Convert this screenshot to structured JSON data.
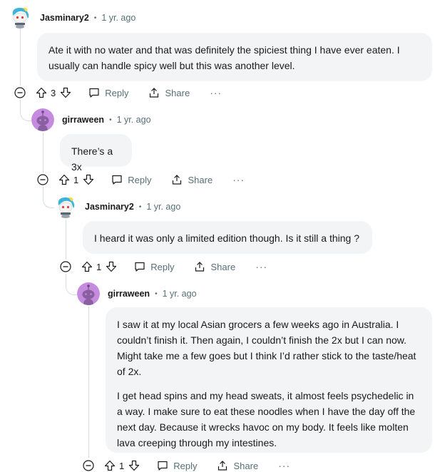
{
  "comments": [
    {
      "author": "Jasminary2",
      "separator": "•",
      "time": "1 yr. ago",
      "body": [
        "Ate it with no water and that was definitely the spiciest thing I have ever eaten. I usually can handle spicy well but this was another level."
      ],
      "score": "3",
      "reply": "Reply",
      "share": "Share",
      "more": "···"
    },
    {
      "author": "girraween",
      "separator": "•",
      "time": "1 yr. ago",
      "body": [
        "There’s a 3x"
      ],
      "score": "1",
      "reply": "Reply",
      "share": "Share",
      "more": "···"
    },
    {
      "author": "Jasminary2",
      "separator": "•",
      "time": "1 yr. ago",
      "body": [
        "I heard it was only a limited edition though. Is it still a thing ?"
      ],
      "score": "1",
      "reply": "Reply",
      "share": "Share",
      "more": "···"
    },
    {
      "author": "girraween",
      "separator": "•",
      "time": "1 yr. ago",
      "body": [
        "I saw it at my local Asian grocers a few weeks ago in Australia. I couldn’t finish it. Then again, I couldn’t finish the 2x but I can now. Might take me a few goes but I think I’d rather stick to the taste/heat of 2x.",
        "I get head spins and my head sweats, it almost feels psychedelic in a way. I make sure to eat these noodles when I have the day off the next day. Because it wrecks havoc on my body. It feels like molten lava creeping through my intestines."
      ],
      "score": "1",
      "reply": "Reply",
      "share": "Share",
      "more": "···"
    }
  ],
  "colors": {
    "bubble": "#f2f4f5",
    "meta": "#576f76",
    "thread_line": "#d8dde3",
    "avatar_purple": "#c58be0"
  }
}
